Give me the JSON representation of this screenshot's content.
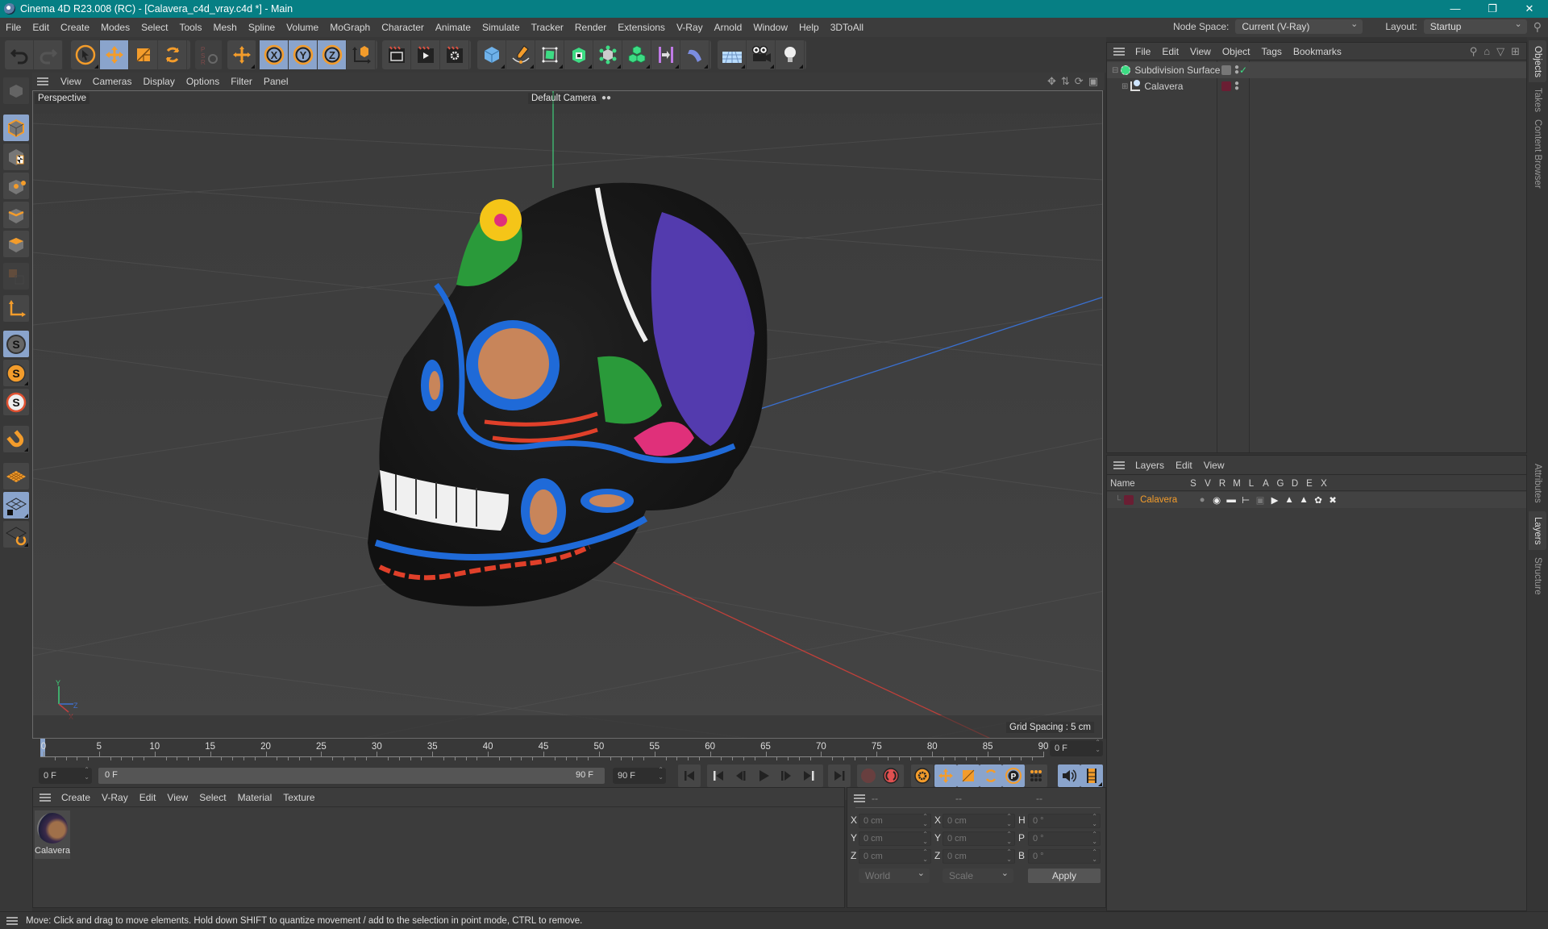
{
  "window": {
    "title": "Cinema 4D R23.008 (RC) - [Calavera_c4d_vray.c4d *] - Main",
    "controls": [
      "minimize",
      "restore",
      "close"
    ]
  },
  "menubar": {
    "items": [
      "File",
      "Edit",
      "Create",
      "Modes",
      "Select",
      "Tools",
      "Mesh",
      "Spline",
      "Volume",
      "MoGraph",
      "Character",
      "Animate",
      "Simulate",
      "Tracker",
      "Render",
      "Extensions",
      "V-Ray",
      "Arnold",
      "Window",
      "Help",
      "3DToAll"
    ],
    "node_space_label": "Node Space:",
    "node_space_value": "Current (V-Ray)",
    "layout_label": "Layout:",
    "layout_value": "Startup"
  },
  "toolbar": {
    "groups": [
      [
        "undo-icon",
        "redo-icon"
      ],
      [
        "select-icon",
        "move-icon",
        "scale-icon",
        "rotate-icon"
      ],
      [
        "psr-icon"
      ],
      [
        "add-icon"
      ],
      [
        "x-axis-icon",
        "y-axis-icon",
        "z-axis-icon",
        "coordinate-system-icon"
      ],
      [
        "render-view-icon",
        "render-picture-viewer-icon",
        "render-settings-icon"
      ],
      [
        "cube-icon",
        "pen-icon",
        "subdivision-icon",
        "extrude-icon",
        "mograph-cloner-icon",
        "array-icon",
        "deformer-icon",
        "bend-icon"
      ],
      [
        "floor-icon",
        "camera-icon",
        "light-icon"
      ]
    ]
  },
  "left_tools": [
    "model-mode-icon",
    "texture-mode-icon",
    "points-mode-icon",
    "edges-mode-icon",
    "polygons-mode-icon",
    "uvw-mode-icon",
    "axis-icon",
    "snap-icon",
    "snap-settings-icon",
    "quantize-icon",
    "magnet-icon",
    "workplane-icon",
    "locked-workplane-icon",
    "workplane-rotate-icon"
  ],
  "viewport": {
    "menu": [
      "View",
      "Cameras",
      "Display",
      "Options",
      "Filter",
      "Panel"
    ],
    "label": "Perspective",
    "camera": "Default Camera",
    "grid_spacing": "Grid Spacing : 5 cm",
    "axes": {
      "x": "#c04040",
      "y": "#40c080",
      "z": "#4070d0"
    }
  },
  "timeline": {
    "ticks": [
      "0",
      "5",
      "10",
      "15",
      "20",
      "25",
      "30",
      "35",
      "40",
      "45",
      "50",
      "55",
      "60",
      "65",
      "70",
      "75",
      "80",
      "85",
      "90"
    ],
    "current_frame": "0 F",
    "start_field": "0 F",
    "range_start": "0 F",
    "range_end": "90 F",
    "end_field": "90 F"
  },
  "material_panel": {
    "menu": [
      "Create",
      "V-Ray",
      "Edit",
      "View",
      "Select",
      "Material",
      "Texture"
    ],
    "materials": [
      {
        "name": "Calavera"
      }
    ]
  },
  "coord_panel": {
    "headers": [
      "--",
      "--",
      "--"
    ],
    "rows": [
      {
        "l1": "X",
        "v1": "0 cm",
        "l2": "X",
        "v2": "0 cm",
        "l3": "H",
        "v3": "0 °"
      },
      {
        "l1": "Y",
        "v1": "0 cm",
        "l2": "Y",
        "v2": "0 cm",
        "l3": "P",
        "v3": "0 °"
      },
      {
        "l1": "Z",
        "v1": "0 cm",
        "l2": "Z",
        "v2": "0 cm",
        "l3": "B",
        "v3": "0 °"
      }
    ],
    "space": "World",
    "mode": "Scale",
    "apply": "Apply"
  },
  "objects_panel": {
    "menu": [
      "File",
      "Edit",
      "View",
      "Object",
      "Tags",
      "Bookmarks"
    ],
    "items": [
      {
        "name": "Subdivision Surface",
        "color": "#888888"
      },
      {
        "name": "Calavera",
        "color": "#6a1e33"
      }
    ]
  },
  "layers_panel": {
    "menu": [
      "Layers",
      "Edit",
      "View"
    ],
    "columns": [
      "Name",
      "S",
      "V",
      "R",
      "M",
      "L",
      "A",
      "G",
      "D",
      "E",
      "X"
    ],
    "layers": [
      {
        "name": "Calavera",
        "color": "#6a1e33"
      }
    ]
  },
  "side_tabs": {
    "top": [
      "Objects",
      "Takes",
      "Content Browser"
    ],
    "bottom": [
      "Attributes",
      "Layers",
      "Structure"
    ]
  },
  "status": "Move: Click and drag to move elements. Hold down SHIFT to quantize movement / add to the selection in point mode, CTRL to remove.",
  "colors": {
    "accent_orange": "#f39c2b",
    "selected_blue": "#8aa4cc",
    "title_teal": "#067f84"
  }
}
